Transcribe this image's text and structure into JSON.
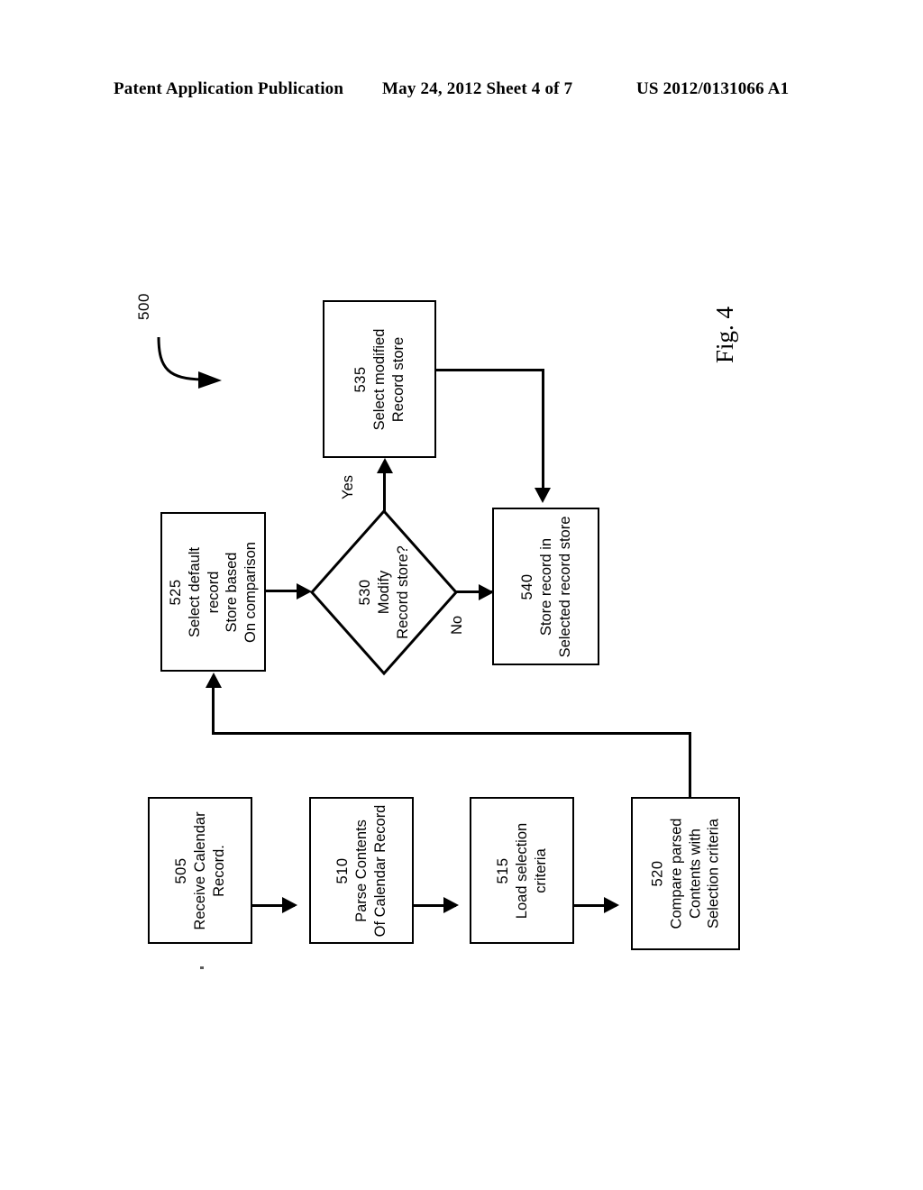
{
  "header": {
    "left": "Patent Application Publication",
    "middle": "May 24, 2012  Sheet 4 of 7",
    "right": "US 2012/0131066 A1"
  },
  "figure": {
    "caption": "Fig. 4",
    "reference_numeral": "500"
  },
  "flowchart": {
    "nodes": [
      {
        "id": "505",
        "ref": "505",
        "shape": "rect",
        "lines": [
          "Receive Calendar",
          "Record."
        ]
      },
      {
        "id": "510",
        "ref": "510",
        "shape": "rect",
        "lines": [
          "Parse Contents",
          "Of Calendar Record"
        ]
      },
      {
        "id": "515",
        "ref": "515",
        "shape": "rect",
        "lines": [
          "Load selection",
          "criteria"
        ]
      },
      {
        "id": "520",
        "ref": "520",
        "shape": "rect",
        "lines": [
          "Compare parsed",
          "Contents with",
          "Selection criteria"
        ]
      },
      {
        "id": "525",
        "ref": "525",
        "shape": "rect",
        "lines": [
          "Select default",
          "record",
          "Store based",
          "On comparison"
        ]
      },
      {
        "id": "530",
        "ref": "530",
        "shape": "diamond",
        "lines": [
          "Modify",
          "Record store?"
        ]
      },
      {
        "id": "535",
        "ref": "535",
        "shape": "rect",
        "lines": [
          "Select modified",
          "Record store"
        ]
      },
      {
        "id": "540",
        "ref": "540",
        "shape": "rect",
        "lines": [
          "Store record in",
          "Selected record store"
        ]
      }
    ],
    "edge_labels": {
      "yes": "Yes",
      "no": "No"
    }
  },
  "colors": {
    "ink": "#000000",
    "paper": "#ffffff"
  }
}
